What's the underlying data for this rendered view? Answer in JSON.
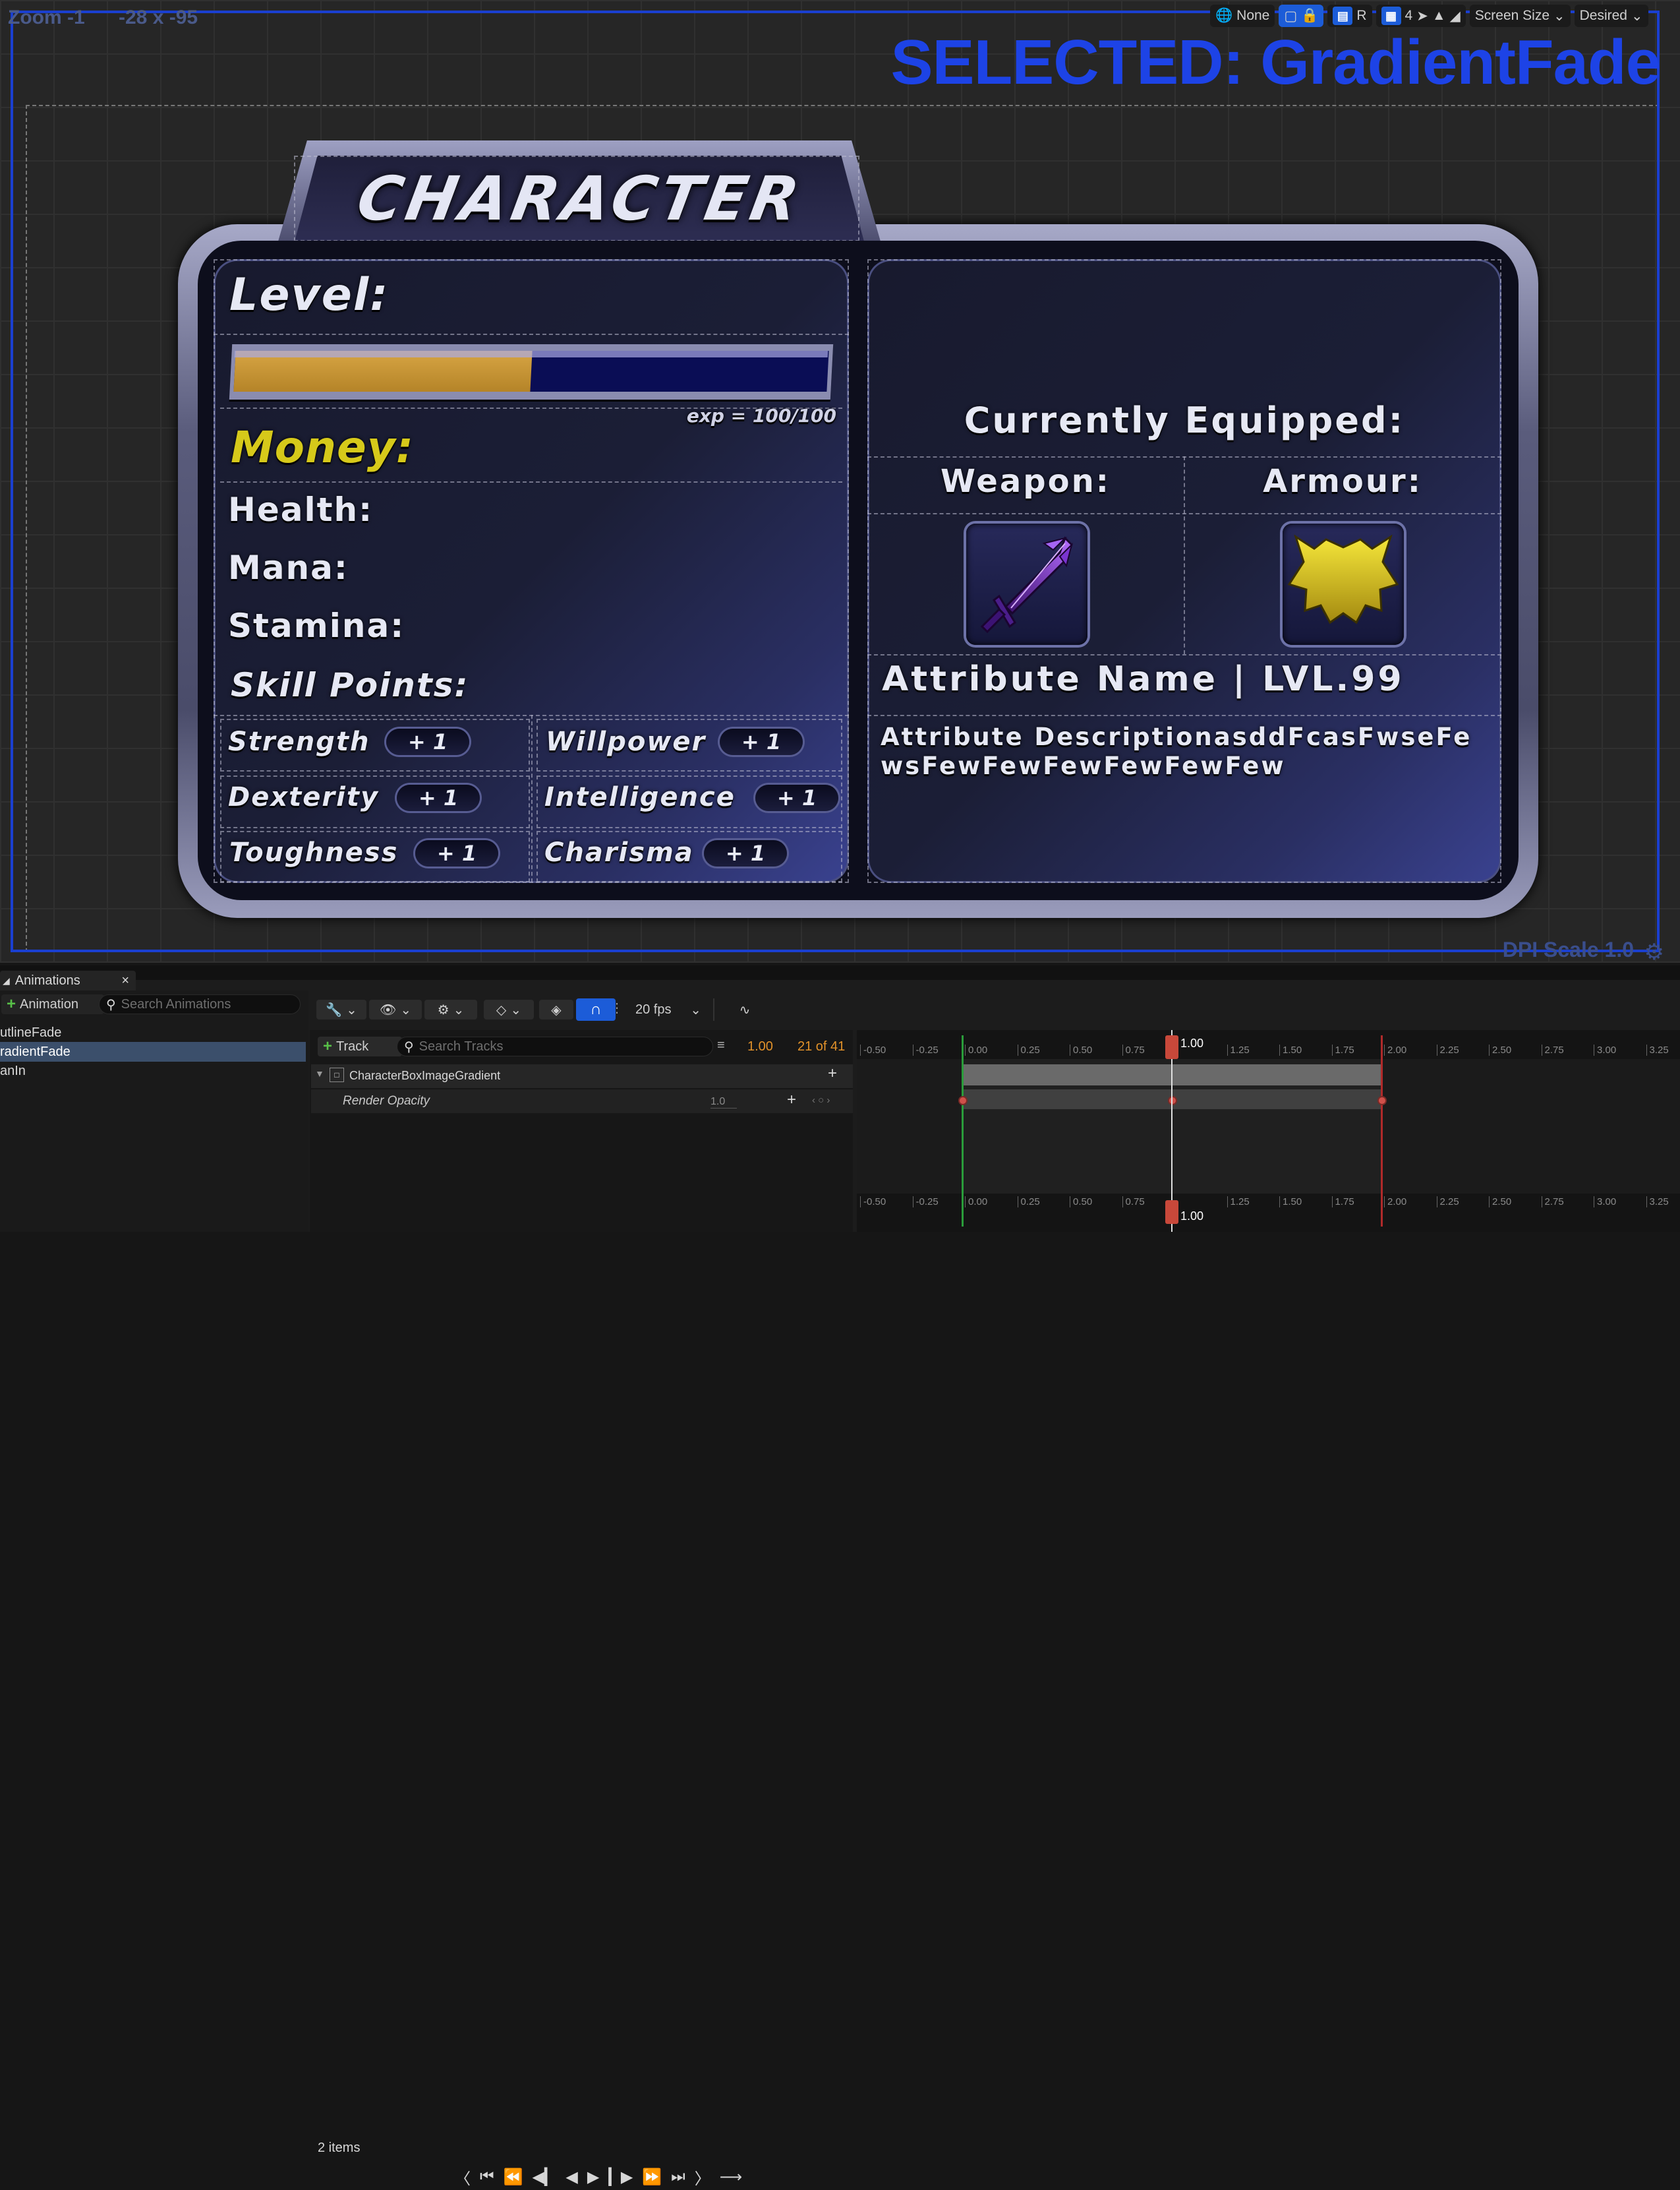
{
  "viewport": {
    "zoom_label": "Zoom -1",
    "coords_label": "-28 x -95",
    "selected_label": "SELECTED: GradientFade",
    "dpi_label": "DPI Scale 1.0",
    "toolbar": {
      "localization": "None",
      "grid_value": "4",
      "r_label": "R",
      "screen_size": "Screen Size",
      "desired": "Desired"
    }
  },
  "character_panel": {
    "title": "CHARACTER",
    "level_label": "Level:",
    "xp_fraction": 0.5,
    "exp_text": "exp = 100/100",
    "money_label": "Money:",
    "stats": [
      "Health:",
      "Mana:",
      "Stamina:"
    ],
    "skill_points_label": "Skill Points:",
    "plus_label": "+ 1",
    "skills": {
      "left": [
        "Strength",
        "Dexterity",
        "Toughness"
      ],
      "right": [
        "Willpower",
        "Intelligence",
        "Charisma"
      ]
    },
    "equipped_label": "Currently Equipped:",
    "weapon_label": "Weapon:",
    "armour_label": "Armour:",
    "attribute_name": "Attribute Name | LVL.99",
    "attribute_description": "Attribute DescriptionasddFcasFwseFewsFewFewFewFewFewFew",
    "colors": {
      "money": "#d6c91a",
      "xp_fill": "#c89938",
      "xp_track": "#0a0d55",
      "weapon": "#8a3de0",
      "armour": "#e0cc1a"
    }
  },
  "animations": {
    "tab_label": "Animations",
    "add_label": "Animation",
    "search_placeholder": "Search Animations",
    "list": [
      "utlineFade",
      "radientFade",
      "anIn"
    ],
    "selected_index": 1,
    "fps_label": "20 fps",
    "track_label": "Track",
    "search_tracks_placeholder": "Search Tracks",
    "current_time": "1.00",
    "frame_counter": "21 of 41",
    "track_name": "CharacterBoxImageGradient",
    "property_name": "Render Opacity",
    "property_value": "1.0",
    "items_count": "2 items",
    "playhead_label": "1.00",
    "ruler_labels": [
      "-0.50",
      "-0.25",
      "0.00",
      "0.25",
      "0.50",
      "0.75",
      "1.25",
      "1.50",
      "1.75",
      "2.00",
      "2.25",
      "2.50",
      "2.75",
      "3.00",
      "3.25"
    ],
    "ruler_values": [
      -0.5,
      -0.25,
      0,
      0.25,
      0.5,
      0.75,
      1.25,
      1.5,
      1.75,
      2.0,
      2.25,
      2.5,
      2.75,
      3.0,
      3.25
    ],
    "keyframes": [
      0,
      1,
      2
    ]
  }
}
